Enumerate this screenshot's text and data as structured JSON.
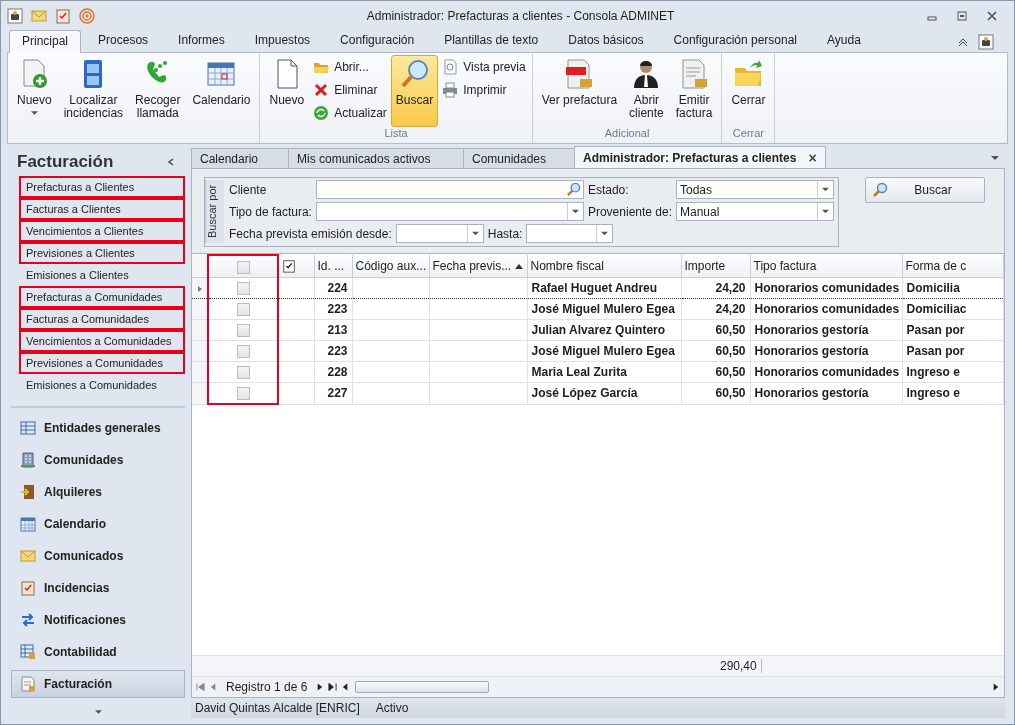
{
  "window": {
    "title": "Administrador: Prefacturas a clientes - Consola ADMINET"
  },
  "ribbon_tabs": [
    {
      "label": "Principal",
      "selected": true
    },
    {
      "label": "Procesos",
      "selected": false
    },
    {
      "label": "Informes",
      "selected": false
    },
    {
      "label": "Impuestos",
      "selected": false
    },
    {
      "label": "Configuración",
      "selected": false
    },
    {
      "label": "Plantillas de texto",
      "selected": false
    },
    {
      "label": "Datos básicos",
      "selected": false
    },
    {
      "label": "Configuración personal",
      "selected": false
    },
    {
      "label": "Ayuda",
      "selected": false
    }
  ],
  "ribbon_groups": [
    {
      "items": [
        {
          "kind": "large",
          "label": "Nuevo",
          "dropdown": true,
          "selected": false
        },
        {
          "kind": "large",
          "label": "Localizar\nincidencias",
          "selected": false
        },
        {
          "kind": "large",
          "label": "Recoger\nllamada",
          "selected": false
        },
        {
          "kind": "large",
          "label": "Calendario",
          "selected": false
        }
      ]
    },
    {
      "label": "Lista",
      "items": [
        {
          "kind": "large",
          "label": "Nuevo",
          "selected": false
        },
        {
          "kind": "stack",
          "buttons": [
            {
              "label": "Abrir..."
            },
            {
              "label": "Eliminar"
            },
            {
              "label": "Actualizar"
            }
          ]
        },
        {
          "kind": "large",
          "label": "Buscar",
          "selected": true
        },
        {
          "kind": "stack",
          "buttons": [
            {
              "label": "Vista previa"
            },
            {
              "label": "Imprimir"
            }
          ]
        }
      ]
    },
    {
      "label": "Adicional",
      "items": [
        {
          "kind": "large",
          "label": "Ver prefactura",
          "selected": false
        },
        {
          "kind": "large",
          "label": "Abrir\ncliente",
          "selected": false
        },
        {
          "kind": "large",
          "label": "Emitir\nfactura",
          "selected": false
        }
      ]
    },
    {
      "label": "Cerrar",
      "items": [
        {
          "kind": "large",
          "label": "Cerrar",
          "selected": false
        }
      ]
    }
  ],
  "sidebar": {
    "title": "Facturación",
    "items": [
      {
        "label": "Prefacturas a Clientes",
        "highlighted": true
      },
      {
        "label": "Facturas a Clientes",
        "highlighted": true
      },
      {
        "label": "Vencimientos a Clientes",
        "highlighted": true
      },
      {
        "label": "Previsiones a Clientes",
        "highlighted": true
      },
      {
        "label": "Emisiones a Clientes",
        "highlighted": false
      },
      {
        "label": "Prefacturas a Comunidades",
        "highlighted": true
      },
      {
        "label": "Facturas a Comunidades",
        "highlighted": true
      },
      {
        "label": "Vencimientos a Comunidades",
        "highlighted": true
      },
      {
        "label": "Previsiones a Comunidades",
        "highlighted": true
      },
      {
        "label": "Emisiones a Comunidades",
        "highlighted": false
      }
    ],
    "modules": [
      {
        "label": "Entidades generales",
        "selected": false
      },
      {
        "label": "Comunidades",
        "selected": false
      },
      {
        "label": "Alquileres",
        "selected": false
      },
      {
        "label": "Calendario",
        "selected": false
      },
      {
        "label": "Comunicados",
        "selected": false
      },
      {
        "label": "Incidencias",
        "selected": false
      },
      {
        "label": "Notificaciones",
        "selected": false
      },
      {
        "label": "Contabilidad",
        "selected": false
      },
      {
        "label": "Facturación",
        "selected": true
      }
    ]
  },
  "document_tabs": [
    {
      "label": "Calendario",
      "selected": false
    },
    {
      "label": "Mis comunicados activos",
      "selected": false
    },
    {
      "label": "Comunidades",
      "selected": false
    },
    {
      "label": "Administrador: Prefacturas a clientes",
      "selected": true,
      "close": "×"
    }
  ],
  "filter": {
    "group_label": "Buscar por",
    "cliente": {
      "label": "Cliente"
    },
    "estado": {
      "label": "Estado:",
      "value": "Todas"
    },
    "tipo_factura": {
      "label": "Tipo de factura:"
    },
    "proveniente": {
      "label": "Proveniente de:",
      "value": "Manual"
    },
    "fecha_desde": {
      "label": "Fecha prevista emisión desde:"
    },
    "hasta": {
      "label": "Hasta:"
    },
    "search_button": "Buscar"
  },
  "grid": {
    "checkbox_column": {
      "checked": false,
      "highlighted": true
    },
    "columns": [
      {
        "label": "Id. ..."
      },
      {
        "label": "Código aux..."
      },
      {
        "label": "Fecha previs...",
        "sorted_ascending": true
      },
      {
        "label": "Nombre fiscal"
      },
      {
        "label": "Importe"
      },
      {
        "label": "Tipo factura"
      },
      {
        "label": "Forma de c"
      }
    ],
    "rows": [
      {
        "selected": true,
        "checked": false,
        "cells": [
          "224",
          "",
          "",
          "Rafael Huguet Andreu",
          "24,20",
          "Honorarios comunidades",
          "Domicilia"
        ]
      },
      {
        "selected": false,
        "checked": false,
        "cells": [
          "223",
          "",
          "",
          "José Miguel Mulero Egea",
          "24,20",
          "Honorarios comunidades",
          "Domiciliac"
        ]
      },
      {
        "selected": false,
        "checked": false,
        "cells": [
          "213",
          "",
          "",
          "Julian Alvarez Quintero",
          "60,50",
          "Honorarios gestoría",
          "Pasan por"
        ]
      },
      {
        "selected": false,
        "checked": false,
        "cells": [
          "223",
          "",
          "",
          "José Miguel Mulero Egea",
          "60,50",
          "Honorarios gestoría",
          "Pasan por"
        ]
      },
      {
        "selected": false,
        "checked": false,
        "cells": [
          "228",
          "",
          "",
          "Maria Leal Zurita",
          "60,50",
          "Honorarios comunidades",
          "Ingreso e"
        ]
      },
      {
        "selected": false,
        "checked": false,
        "cells": [
          "227",
          "",
          "",
          "José López García",
          "60,50",
          "Honorarios gestoría",
          "Ingreso e"
        ]
      }
    ],
    "total": "290,40",
    "navigator": "Registro 1 de 6"
  },
  "status_bar": [
    "David Quintas Alcalde [ENRIC]",
    "Activo"
  ]
}
